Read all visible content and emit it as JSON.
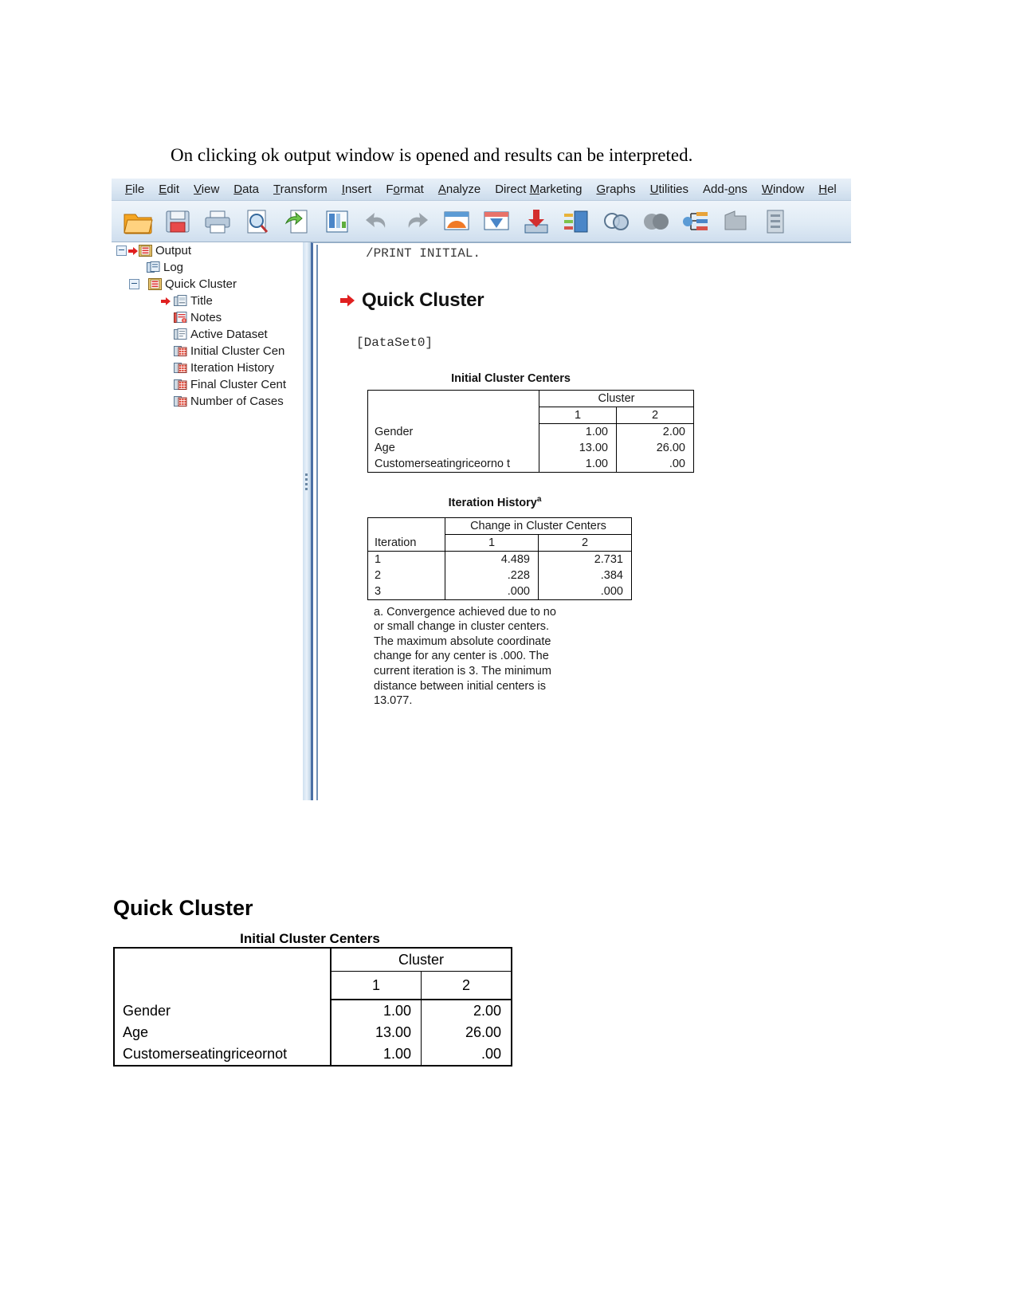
{
  "intro": {
    "text": "On clicking ok output window is opened and results can be interpreted."
  },
  "spss_window": {
    "menubar": {
      "items": [
        {
          "name": "file",
          "label": "File",
          "accel": "F"
        },
        {
          "name": "edit",
          "label": "Edit",
          "accel": "E"
        },
        {
          "name": "view",
          "label": "View",
          "accel": "V"
        },
        {
          "name": "data",
          "label": "Data",
          "accel": "D"
        },
        {
          "name": "transform",
          "label": "Transform",
          "accel": "T"
        },
        {
          "name": "insert",
          "label": "Insert",
          "accel": "I"
        },
        {
          "name": "format",
          "label": "Format",
          "accel": "o"
        },
        {
          "name": "analyze",
          "label": "Analyze",
          "accel": "A"
        },
        {
          "name": "direct-marketing",
          "label": "Direct Marketing",
          "accel": "M"
        },
        {
          "name": "graphs",
          "label": "Graphs",
          "accel": "G"
        },
        {
          "name": "utilities",
          "label": "Utilities",
          "accel": "U"
        },
        {
          "name": "add-ons",
          "label": "Add-ons",
          "accel": "o"
        },
        {
          "name": "window",
          "label": "Window",
          "accel": "W"
        },
        {
          "name": "help",
          "label": "Hel",
          "accel": "H"
        }
      ]
    },
    "toolbar": {
      "buttons": [
        {
          "name": "open-file-icon",
          "title": "Open data document"
        },
        {
          "name": "save-icon",
          "title": "Save this document"
        },
        {
          "name": "print-icon",
          "title": "Print"
        },
        {
          "name": "print-preview-icon",
          "title": "Print Preview"
        },
        {
          "name": "export-icon",
          "title": "Export"
        },
        {
          "name": "recall-dialogs-icon",
          "title": "Recall recently used dialogs"
        },
        {
          "name": "undo-icon",
          "title": "Undo"
        },
        {
          "name": "redo-icon",
          "title": "Redo"
        },
        {
          "name": "goto-case-icon",
          "title": "Go to case"
        },
        {
          "name": "goto-variable-icon",
          "title": "Go to variable"
        },
        {
          "name": "insert-new-icon",
          "title": "Insert"
        },
        {
          "name": "variables-icon",
          "title": "Variables"
        },
        {
          "name": "find-icon",
          "title": "Find"
        },
        {
          "name": "select-cases-icon",
          "title": "Select cases"
        },
        {
          "name": "split-file-icon",
          "title": "Split file"
        },
        {
          "name": "weight-cases-icon",
          "title": "Weight cases"
        },
        {
          "name": "value-labels-icon",
          "title": "Value labels"
        }
      ]
    },
    "tree": {
      "items": [
        {
          "name": "output",
          "label": "Output",
          "depth": 0,
          "expander": true,
          "arrow": true,
          "icon": "output-icon"
        },
        {
          "name": "log",
          "label": "Log",
          "depth": 1,
          "expander": false,
          "arrow": false,
          "icon": "log-icon"
        },
        {
          "name": "quick-cluster",
          "label": "Quick Cluster",
          "depth": 1,
          "expander": true,
          "arrow": false,
          "icon": "output-icon"
        },
        {
          "name": "title",
          "label": "Title",
          "depth": 2,
          "expander": false,
          "arrow": true,
          "icon": "title-icon"
        },
        {
          "name": "notes",
          "label": "Notes",
          "depth": 2,
          "expander": false,
          "arrow": false,
          "icon": "notes-icon"
        },
        {
          "name": "active-dataset",
          "label": "Active Dataset",
          "depth": 2,
          "expander": false,
          "arrow": false,
          "icon": "dataset-icon"
        },
        {
          "name": "initial-cluster-centers",
          "label": "Initial Cluster Cen",
          "depth": 2,
          "expander": false,
          "arrow": false,
          "icon": "table-icon"
        },
        {
          "name": "iteration-history",
          "label": "Iteration History",
          "depth": 2,
          "expander": false,
          "arrow": false,
          "icon": "table-icon"
        },
        {
          "name": "final-cluster-centers",
          "label": "Final Cluster Cent",
          "depth": 2,
          "expander": false,
          "arrow": false,
          "icon": "table-icon"
        },
        {
          "name": "number-of-cases",
          "label": "Number of Cases",
          "depth": 2,
          "expander": false,
          "arrow": false,
          "icon": "table-icon"
        }
      ]
    },
    "output": {
      "syntax_line": "/PRINT INITIAL.",
      "heading": "Quick Cluster",
      "dataset_line": "[DataSet0]",
      "initial_cluster_centers": {
        "title": "Initial Cluster Centers",
        "group_header": "Cluster",
        "column_headers": [
          "1",
          "2"
        ],
        "rows": [
          {
            "label": "Gender",
            "values": [
              "1.00",
              "2.00"
            ]
          },
          {
            "label": "Age",
            "values": [
              "13.00",
              "26.00"
            ]
          },
          {
            "label": "Customerseatingriceorno t",
            "values": [
              "1.00",
              ".00"
            ]
          }
        ]
      },
      "iteration_history": {
        "title": "Iteration History",
        "title_superscript": "a",
        "group_header": "Change in Cluster Centers",
        "row_header": "Iteration",
        "column_headers": [
          "1",
          "2"
        ],
        "rows": [
          {
            "label": "1",
            "values": [
              "4.489",
              "2.731"
            ]
          },
          {
            "label": "2",
            "values": [
              ".228",
              ".384"
            ]
          },
          {
            "label": "3",
            "values": [
              ".000",
              ".000"
            ]
          }
        ],
        "footnote_marker": "a.",
        "footnote_text": "Convergence achieved due to no or small change in cluster centers. The maximum absolute coordinate change for any center is .000. The current iteration is 3. The minimum distance between initial centers is 13.077."
      }
    }
  },
  "document": {
    "heading": "Quick Cluster",
    "table": {
      "title": "Initial Cluster Centers",
      "group_header": "Cluster",
      "column_headers": [
        "1",
        "2"
      ],
      "rows": [
        {
          "label": "Gender",
          "values": [
            "1.00",
            "2.00"
          ]
        },
        {
          "label": "Age",
          "values": [
            "13.00",
            "26.00"
          ]
        },
        {
          "label": "Customerseatingriceornot",
          "values": [
            "1.00",
            ".00"
          ]
        }
      ]
    }
  }
}
